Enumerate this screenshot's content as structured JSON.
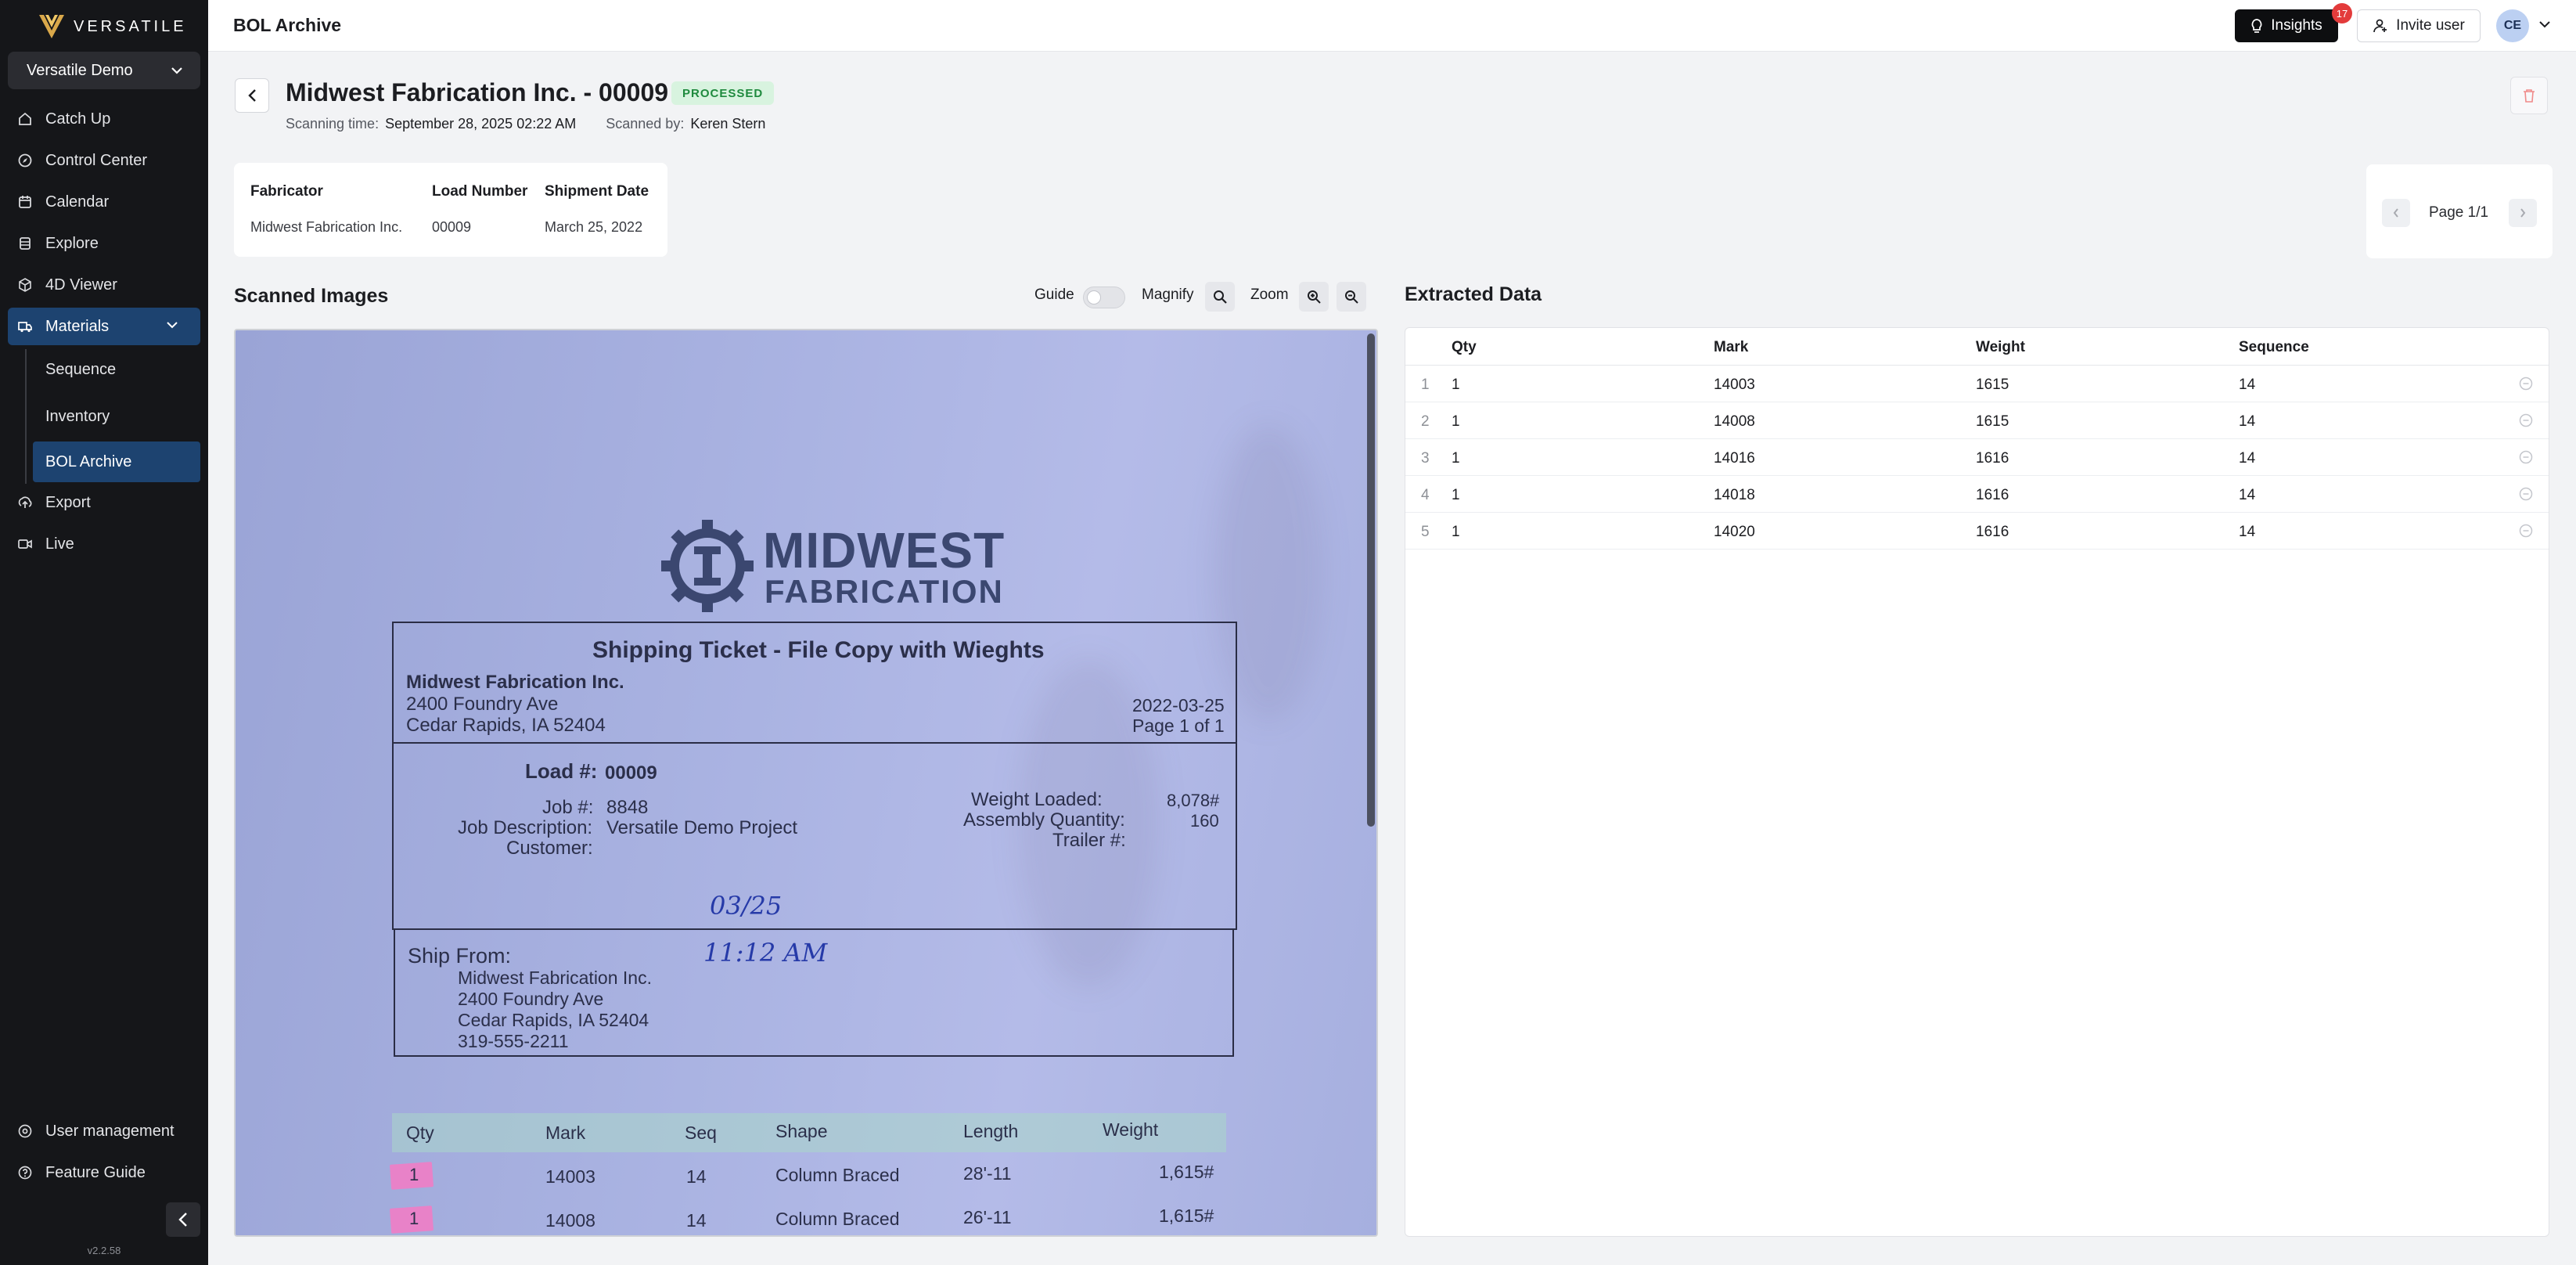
{
  "app": {
    "brand": "VERSATILE",
    "version": "v2.2.58"
  },
  "sidebar": {
    "workspace": "Versatile Demo",
    "items": [
      {
        "label": "Catch Up",
        "icon": "home-icon"
      },
      {
        "label": "Control Center",
        "icon": "compass-icon"
      },
      {
        "label": "Calendar",
        "icon": "calendar-icon"
      },
      {
        "label": "Explore",
        "icon": "layers-icon"
      },
      {
        "label": "4D Viewer",
        "icon": "cube-icon"
      },
      {
        "label": "Materials",
        "icon": "truck-icon"
      },
      {
        "label": "Export",
        "icon": "export-icon"
      },
      {
        "label": "Live",
        "icon": "video-icon"
      }
    ],
    "subitems": [
      {
        "label": "Sequence"
      },
      {
        "label": "Inventory"
      },
      {
        "label": "BOL Archive"
      }
    ],
    "bottom_items": [
      {
        "label": "User management",
        "icon": "user-gear-icon"
      },
      {
        "label": "Feature Guide",
        "icon": "help-icon"
      }
    ]
  },
  "topbar": {
    "title": "BOL Archive",
    "insights_label": "Insights",
    "insights_badge": "17",
    "invite_label": "Invite user",
    "avatar_initials": "CE"
  },
  "document": {
    "title": "Midwest Fabrication Inc. - 00009",
    "status": "PROCESSED",
    "scanning_time_label": "Scanning time:",
    "scanning_time": "September 28, 2025 02:22 AM",
    "scanned_by_label": "Scanned by:",
    "scanned_by": "Keren Stern"
  },
  "info": {
    "fabricator_label": "Fabricator",
    "fabricator": "Midwest Fabrication Inc.",
    "load_number_label": "Load Number",
    "load_number": "00009",
    "shipment_date_label": "Shipment Date",
    "shipment_date": "March 25, 2022"
  },
  "pager": {
    "text": "Page 1/1"
  },
  "scanned": {
    "title": "Scanned Images",
    "guide_label": "Guide",
    "magnify_label": "Magnify",
    "zoom_label": "Zoom"
  },
  "scan_document": {
    "logo_line1": "MIDWEST",
    "logo_line2": "FABRICATION",
    "heading": "Shipping Ticket - File Copy with Wieghts",
    "company": "Midwest Fabrication Inc.",
    "address1": "2400 Foundry Ave",
    "address2": "Cedar Rapids, IA 52404",
    "date": "2022-03-25",
    "page": "Page 1 of 1",
    "load_label": "Load #:",
    "load_value": "00009",
    "job_label": "Job #:",
    "job_value": "8848",
    "jobdesc_label": "Job Description:",
    "jobdesc_value": "Versatile Demo Project",
    "customer_label": "Customer:",
    "weight_loaded_label": "Weight Loaded:",
    "weight_loaded_value": "8,078#",
    "assembly_qty_label": "Assembly Quantity:",
    "assembly_qty_value": "160",
    "trailer_label": "Trailer #:",
    "hand_date": "03/25",
    "hand_time": "11:12 AM",
    "ship_from_label": "Ship From:",
    "ship_from_name": "Midwest Fabrication Inc.",
    "ship_from_addr1": "2400 Foundry Ave",
    "ship_from_addr2": "Cedar Rapids, IA 52404",
    "ship_from_phone": "319-555-2211",
    "table_headers": [
      "Qty",
      "Mark",
      "Seq",
      "Shape",
      "Length",
      "Weight"
    ],
    "rows": [
      {
        "qty": "1",
        "mark": "14003",
        "seq": "14",
        "shape": "Column Braced",
        "length": "28'-11",
        "weight": "1,615#"
      },
      {
        "qty": "1",
        "mark": "14008",
        "seq": "14",
        "shape": "Column Braced",
        "length": "26'-11",
        "weight": "1,615#"
      }
    ]
  },
  "extracted": {
    "title": "Extracted Data",
    "headers": [
      "Qty",
      "Mark",
      "Weight",
      "Sequence"
    ],
    "rows": [
      {
        "idx": "1",
        "qty": "1",
        "mark": "14003",
        "weight": "1615",
        "sequence": "14"
      },
      {
        "idx": "2",
        "qty": "1",
        "mark": "14008",
        "weight": "1615",
        "sequence": "14"
      },
      {
        "idx": "3",
        "qty": "1",
        "mark": "14016",
        "weight": "1616",
        "sequence": "14"
      },
      {
        "idx": "4",
        "qty": "1",
        "mark": "14018",
        "weight": "1616",
        "sequence": "14"
      },
      {
        "idx": "5",
        "qty": "1",
        "mark": "14020",
        "weight": "1616",
        "sequence": "14"
      }
    ]
  },
  "colors": {
    "sidebar_bg": "#151619",
    "active_nav": "#1d4370",
    "status_bg": "#d8f3df",
    "status_fg": "#1f8a3e",
    "badge": "#e33b3b"
  }
}
